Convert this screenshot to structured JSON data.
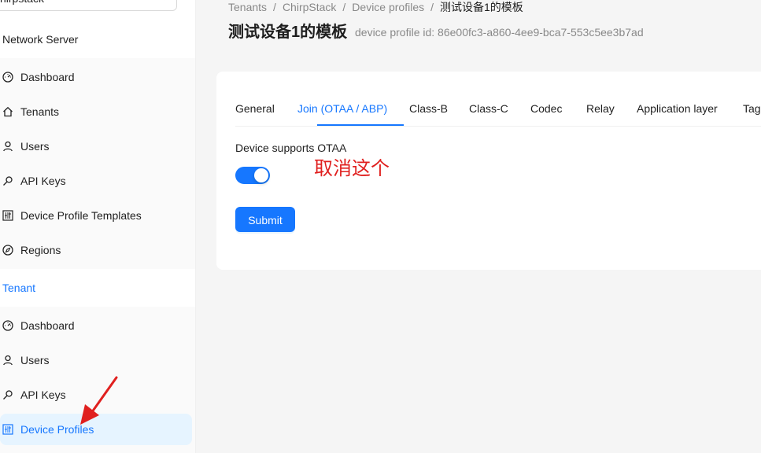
{
  "sidebar": {
    "tenant_select": {
      "value": "hirpstack"
    },
    "network_server_title": "Network Server",
    "network_items": [
      {
        "label": "Dashboard",
        "icon": "dashboard-icon"
      },
      {
        "label": "Tenants",
        "icon": "home-icon"
      },
      {
        "label": "Users",
        "icon": "user-icon"
      },
      {
        "label": "API Keys",
        "icon": "key-icon"
      },
      {
        "label": "Device Profile Templates",
        "icon": "control-icon"
      },
      {
        "label": "Regions",
        "icon": "compass-icon"
      }
    ],
    "tenant_title": "Tenant",
    "tenant_items": [
      {
        "label": "Dashboard",
        "icon": "dashboard-icon"
      },
      {
        "label": "Users",
        "icon": "user-icon"
      },
      {
        "label": "API Keys",
        "icon": "key-icon"
      },
      {
        "label": "Device Profiles",
        "icon": "control-icon",
        "selected": true
      }
    ]
  },
  "breadcrumb": {
    "items": [
      "Tenants",
      "ChirpStack",
      "Device profiles"
    ],
    "current": "测试设备1的模板",
    "separator": "/"
  },
  "header": {
    "title": "测试设备1的模板",
    "subtitle": "device profile id: 86e00fc3-a860-4ee9-bca7-553c5ee3b7ad"
  },
  "tabs": [
    {
      "label": "General"
    },
    {
      "label": "Join (OTAA / ABP)",
      "active": true
    },
    {
      "label": "Class-B"
    },
    {
      "label": "Class-C"
    },
    {
      "label": "Codec"
    },
    {
      "label": "Relay"
    },
    {
      "label": "Application layer"
    },
    {
      "label": "Tags"
    }
  ],
  "form": {
    "supports_otaa_label": "Device supports OTAA",
    "supports_otaa_enabled": true,
    "submit_label": "Submit"
  },
  "annotation": {
    "text": "取消这个",
    "color": "#e0201f"
  },
  "colors": {
    "primary": "#1677ff",
    "annotation_red": "#e0201f"
  }
}
